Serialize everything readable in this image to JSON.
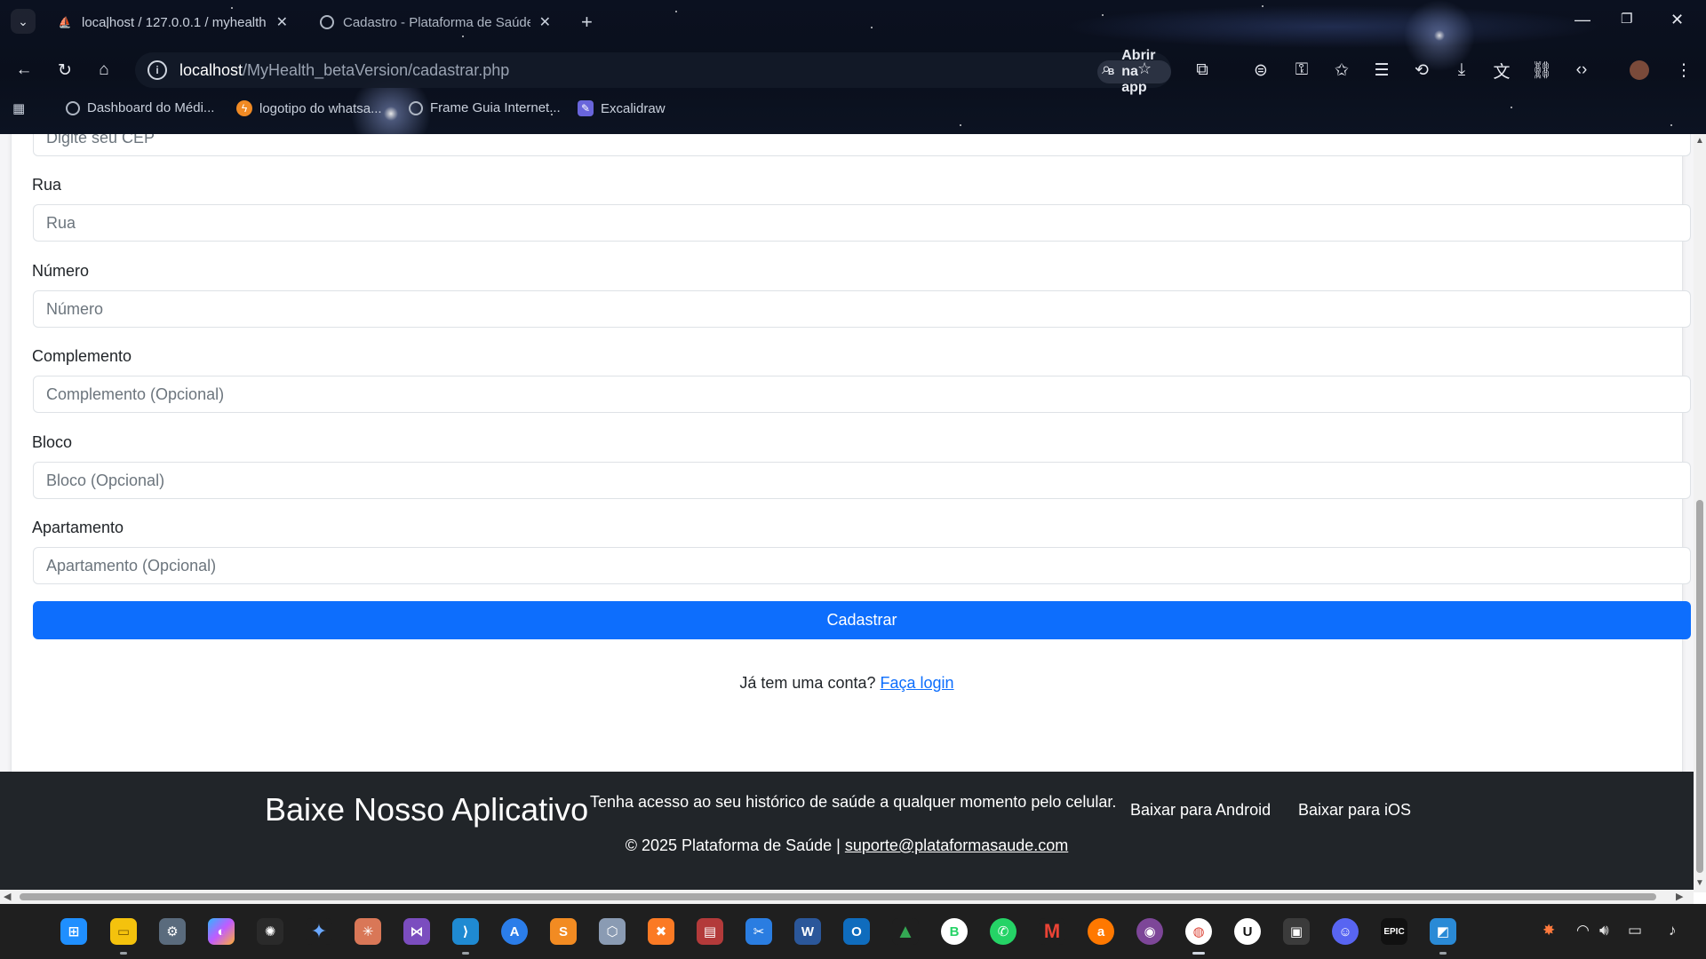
{
  "browser": {
    "tabs": [
      {
        "title": "localhost / 127.0.0.1 / myhealth",
        "icon": "phpmyadmin-icon"
      },
      {
        "title": "Cadastro - Plataforma de Saúde",
        "icon": "globe-icon"
      }
    ],
    "url_host": "localhost",
    "url_path": "/MyHealth_betaVersion/cadastrar.php",
    "open_app_label": "Abrir na app",
    "bookmarks": [
      {
        "label": "Dashboard do Médi...",
        "icon": "globe-icon"
      },
      {
        "label": "logotipo do whatsa...",
        "icon": "bolt-icon"
      },
      {
        "label": "Frame Guia Internet...",
        "icon": "globe-icon"
      },
      {
        "label": "Excalidraw",
        "icon": "excalidraw-icon"
      }
    ]
  },
  "form": {
    "cep_placeholder": "Digite seu CEP",
    "rua_label": "Rua",
    "rua_placeholder": "Rua",
    "numero_label": "Número",
    "numero_placeholder": "Número",
    "complemento_label": "Complemento",
    "complemento_placeholder": "Complemento (Opcional)",
    "bloco_label": "Bloco",
    "bloco_placeholder": "Bloco (Opcional)",
    "apartamento_label": "Apartamento",
    "apartamento_placeholder": "Apartamento (Opcional)",
    "submit_label": "Cadastrar",
    "login_prompt": "Já tem uma conta?",
    "login_link": "Faça login"
  },
  "footer": {
    "app_title": "Baixe Nosso Aplicativo",
    "app_subtitle": "Tenha acesso ao seu histórico de saúde a qualquer momento pelo celular.",
    "android_label": "Baixar para Android",
    "ios_label": "Baixar para iOS",
    "copyright": "© 2025 Plataforma de Saúde |",
    "email": "suporte@plataformasaude.com"
  },
  "colors": {
    "primary": "#0d6efd",
    "footer_bg": "#212529",
    "page_bg": "#f5f5f7"
  },
  "taskbar": {
    "apps": [
      "windows-start-icon",
      "file-explorer-icon",
      "settings-icon",
      "copilot-icon",
      "chatgpt-icon",
      "gemini-icon",
      "claude-icon",
      "visual-studio-icon",
      "vscode-icon",
      "app-store-icon",
      "sublime-icon",
      "cube-icon",
      "xampp-icon",
      "archive-icon",
      "snipping-tool-icon",
      "word-icon",
      "outlook-icon",
      "google-drive-icon",
      "whatsapp-business-icon",
      "whatsapp-icon",
      "gmail-icon",
      "avast-icon",
      "tor-icon",
      "chrome-icon",
      "ubisoft-icon",
      "chrome-app-icon",
      "discord-icon",
      "epic-games-icon",
      "photo-editor-icon"
    ],
    "tray": [
      "notification-app-icon",
      "wifi-icon",
      "volume-icon",
      "battery-icon",
      "bell-icon"
    ]
  }
}
